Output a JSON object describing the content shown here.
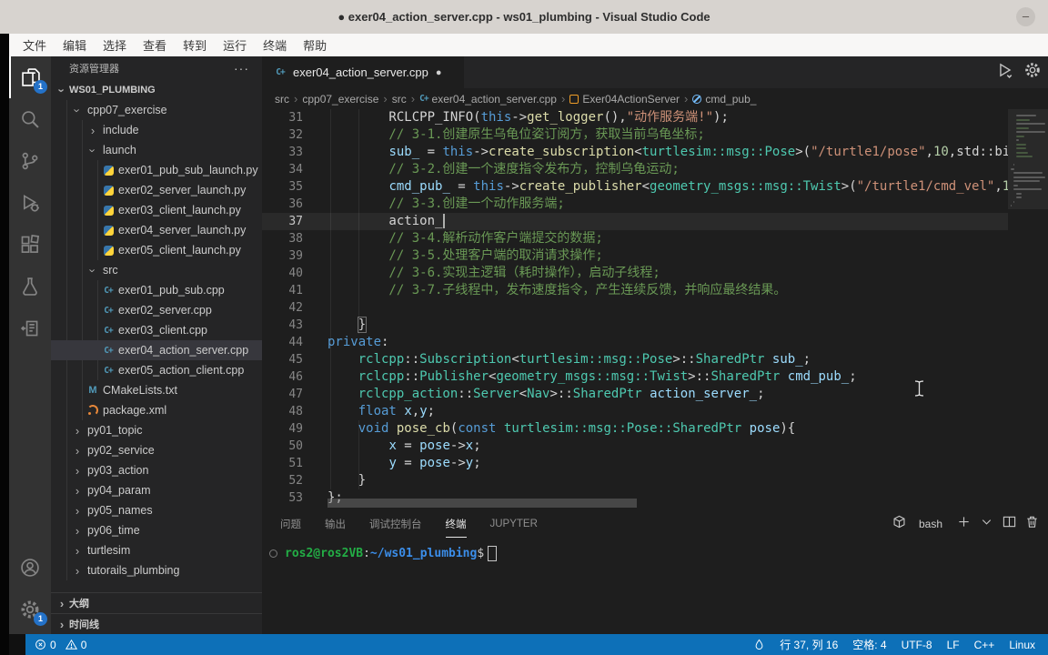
{
  "window": {
    "title": "● exer04_action_server.cpp - ws01_plumbing - Visual Studio Code",
    "minimize_glyph": "–"
  },
  "menu_items": [
    "文件",
    "编辑",
    "选择",
    "查看",
    "转到",
    "运行",
    "终端",
    "帮助"
  ],
  "activity_bar": {
    "top": [
      {
        "name": "explorer",
        "badge": "1",
        "active": true
      },
      {
        "name": "search"
      },
      {
        "name": "source-control"
      },
      {
        "name": "run-debug"
      },
      {
        "name": "extensions"
      },
      {
        "name": "testing"
      },
      {
        "name": "references"
      }
    ],
    "bottom": [
      {
        "name": "account"
      },
      {
        "name": "settings",
        "badge": "1"
      }
    ]
  },
  "sidebar": {
    "header": "资源管理器",
    "more_label": "···",
    "root": "WS01_PLUMBING",
    "tree": [
      {
        "label": "cpp07_exercise",
        "ind": 1,
        "chev": "open"
      },
      {
        "label": "include",
        "ind": 2,
        "chev": "closed"
      },
      {
        "label": "launch",
        "ind": 2,
        "chev": "open"
      },
      {
        "label": "exer01_pub_sub_launch.py",
        "ind": 3,
        "icon": "py"
      },
      {
        "label": "exer02_server_launch.py",
        "ind": 3,
        "icon": "py"
      },
      {
        "label": "exer03_client_launch.py",
        "ind": 3,
        "icon": "py"
      },
      {
        "label": "exer04_server_launch.py",
        "ind": 3,
        "icon": "py"
      },
      {
        "label": "exer05_client_launch.py",
        "ind": 3,
        "icon": "py"
      },
      {
        "label": "src",
        "ind": 2,
        "chev": "open"
      },
      {
        "label": "exer01_pub_sub.cpp",
        "ind": 3,
        "icon": "cpp"
      },
      {
        "label": "exer02_server.cpp",
        "ind": 3,
        "icon": "cpp"
      },
      {
        "label": "exer03_client.cpp",
        "ind": 3,
        "icon": "cpp"
      },
      {
        "label": "exer04_action_server.cpp",
        "ind": 3,
        "icon": "cpp",
        "selected": true
      },
      {
        "label": "exer05_action_client.cpp",
        "ind": 3,
        "icon": "cpp"
      },
      {
        "label": "CMakeLists.txt",
        "ind": 2,
        "icon": "m"
      },
      {
        "label": "package.xml",
        "ind": 2,
        "icon": "xml"
      },
      {
        "label": "py01_topic",
        "ind": 1,
        "chev": "closed"
      },
      {
        "label": "py02_service",
        "ind": 1,
        "chev": "closed"
      },
      {
        "label": "py03_action",
        "ind": 1,
        "chev": "closed"
      },
      {
        "label": "py04_param",
        "ind": 1,
        "chev": "closed"
      },
      {
        "label": "py05_names",
        "ind": 1,
        "chev": "closed"
      },
      {
        "label": "py06_time",
        "ind": 1,
        "chev": "closed"
      },
      {
        "label": "turtlesim",
        "ind": 1,
        "chev": "closed"
      },
      {
        "label": "tutorails_plumbing",
        "ind": 1,
        "chev": "closed"
      }
    ],
    "sections": [
      "大纲",
      "时间线"
    ]
  },
  "editor": {
    "tab": {
      "label": "exer04_action_server.cpp",
      "dirty": "●"
    },
    "breadcrumbs": [
      {
        "label": "src"
      },
      {
        "label": "cpp07_exercise"
      },
      {
        "label": "src"
      },
      {
        "label": "exer04_action_server.cpp",
        "icon": "cpp"
      },
      {
        "label": "Exer04ActionServer",
        "icon": "class"
      },
      {
        "label": "cmd_pub_",
        "icon": "field"
      }
    ],
    "code": {
      "cursor_line": 37,
      "lines": [
        {
          "n": 31,
          "segs": [
            [
              "p",
              "        RCLCPP_INFO("
            ],
            [
              "k",
              "this"
            ],
            [
              "p",
              "->"
            ],
            [
              "f",
              "get_logger"
            ],
            [
              "p",
              "(),"
            ],
            [
              "s",
              "\"动作服务端!\""
            ],
            [
              "p",
              ");"
            ]
          ]
        },
        {
          "n": 32,
          "segs": [
            [
              "c",
              "        // 3-1.创建原生乌龟位姿订阅方，获取当前乌龟坐标;"
            ]
          ]
        },
        {
          "n": 33,
          "segs": [
            [
              "p",
              "        "
            ],
            [
              "v",
              "sub_"
            ],
            [
              "p",
              " = "
            ],
            [
              "k",
              "this"
            ],
            [
              "p",
              "->"
            ],
            [
              "f",
              "create_subscription"
            ],
            [
              "p",
              "<"
            ],
            [
              "t",
              "turtlesim::msg::Pose"
            ],
            [
              "p",
              ">("
            ],
            [
              "s",
              "\"/turtle1/pose\""
            ],
            [
              "p",
              ","
            ],
            [
              "n",
              "10"
            ],
            [
              "p",
              ",std::bi"
            ]
          ]
        },
        {
          "n": 34,
          "segs": [
            [
              "c",
              "        // 3-2.创建一个速度指令发布方，控制乌龟运动;"
            ]
          ]
        },
        {
          "n": 35,
          "segs": [
            [
              "p",
              "        "
            ],
            [
              "v",
              "cmd_pub_"
            ],
            [
              "p",
              " = "
            ],
            [
              "k",
              "this"
            ],
            [
              "p",
              "->"
            ],
            [
              "f",
              "create_publisher"
            ],
            [
              "p",
              "<"
            ],
            [
              "t",
              "geometry_msgs::msg::Twist"
            ],
            [
              "p",
              ">("
            ],
            [
              "s",
              "\"/turtle1/cmd_vel\""
            ],
            [
              "p",
              ","
            ],
            [
              "n",
              "1"
            ]
          ]
        },
        {
          "n": 36,
          "segs": [
            [
              "c",
              "        // 3-3.创建一个动作服务端;"
            ]
          ]
        },
        {
          "n": 37,
          "cursor": true,
          "segs": [
            [
              "p",
              "        action_"
            ]
          ]
        },
        {
          "n": 38,
          "segs": [
            [
              "c",
              "        // 3-4.解析动作客户端提交的数据;"
            ]
          ]
        },
        {
          "n": 39,
          "segs": [
            [
              "c",
              "        // 3-5.处理客户端的取消请求操作;"
            ]
          ]
        },
        {
          "n": 40,
          "segs": [
            [
              "c",
              "        // 3-6.实现主逻辑（耗时操作），启动子线程;"
            ]
          ]
        },
        {
          "n": 41,
          "segs": [
            [
              "c",
              "        // 3-7.子线程中，发布速度指令，产生连续反馈，并响应最终结果。"
            ]
          ]
        },
        {
          "n": 42,
          "segs": []
        },
        {
          "n": 43,
          "segs": [
            [
              "p",
              "    "
            ],
            [
              "pb",
              "}"
            ]
          ]
        },
        {
          "n": 44,
          "segs": [
            [
              "k",
              "private"
            ],
            [
              "p",
              ":"
            ]
          ]
        },
        {
          "n": 45,
          "segs": [
            [
              "p",
              "    "
            ],
            [
              "t",
              "rclcpp"
            ],
            [
              "p",
              "::"
            ],
            [
              "t",
              "Subscription"
            ],
            [
              "p",
              "<"
            ],
            [
              "t",
              "turtlesim::msg::Pose"
            ],
            [
              "p",
              ">::"
            ],
            [
              "t",
              "SharedPtr"
            ],
            [
              "p",
              " "
            ],
            [
              "v",
              "sub_"
            ],
            [
              "p",
              ";"
            ]
          ]
        },
        {
          "n": 46,
          "segs": [
            [
              "p",
              "    "
            ],
            [
              "t",
              "rclcpp"
            ],
            [
              "p",
              "::"
            ],
            [
              "t",
              "Publisher"
            ],
            [
              "p",
              "<"
            ],
            [
              "t",
              "geometry_msgs::msg::Twist"
            ],
            [
              "p",
              ">::"
            ],
            [
              "t",
              "SharedPtr"
            ],
            [
              "p",
              " "
            ],
            [
              "v",
              "cmd_pub_"
            ],
            [
              "p",
              ";"
            ]
          ]
        },
        {
          "n": 47,
          "segs": [
            [
              "p",
              "    "
            ],
            [
              "t",
              "rclcpp_action"
            ],
            [
              "p",
              "::"
            ],
            [
              "t",
              "Server"
            ],
            [
              "p",
              "<"
            ],
            [
              "t",
              "Nav"
            ],
            [
              "p",
              ">::"
            ],
            [
              "t",
              "SharedPtr"
            ],
            [
              "p",
              " "
            ],
            [
              "v",
              "action_server_"
            ],
            [
              "p",
              ";"
            ]
          ]
        },
        {
          "n": 48,
          "segs": [
            [
              "p",
              "    "
            ],
            [
              "k",
              "float"
            ],
            [
              "p",
              " "
            ],
            [
              "v",
              "x"
            ],
            [
              "p",
              ","
            ],
            [
              "v",
              "y"
            ],
            [
              "p",
              ";"
            ]
          ]
        },
        {
          "n": 49,
          "segs": [
            [
              "p",
              "    "
            ],
            [
              "k",
              "void"
            ],
            [
              "p",
              " "
            ],
            [
              "f",
              "pose_cb"
            ],
            [
              "p",
              "("
            ],
            [
              "k",
              "const"
            ],
            [
              "p",
              " "
            ],
            [
              "t",
              "turtlesim::msg::Pose::SharedPtr"
            ],
            [
              "p",
              " "
            ],
            [
              "v",
              "pose"
            ],
            [
              "p",
              "){"
            ]
          ]
        },
        {
          "n": 50,
          "segs": [
            [
              "p",
              "        "
            ],
            [
              "v",
              "x"
            ],
            [
              "p",
              " = "
            ],
            [
              "v",
              "pose"
            ],
            [
              "p",
              "->"
            ],
            [
              "v",
              "x"
            ],
            [
              "p",
              ";"
            ]
          ]
        },
        {
          "n": 51,
          "segs": [
            [
              "p",
              "        "
            ],
            [
              "v",
              "y"
            ],
            [
              "p",
              " = "
            ],
            [
              "v",
              "pose"
            ],
            [
              "p",
              "->"
            ],
            [
              "v",
              "y"
            ],
            [
              "p",
              ";"
            ]
          ]
        },
        {
          "n": 52,
          "segs": [
            [
              "p",
              "    }"
            ]
          ]
        },
        {
          "n": 53,
          "segs": [
            [
              "p",
              "};"
            ]
          ]
        }
      ]
    }
  },
  "panel": {
    "tabs": [
      {
        "label": "问题"
      },
      {
        "label": "输出"
      },
      {
        "label": "调试控制台"
      },
      {
        "label": "终端",
        "active": true
      },
      {
        "label": "JUPYTER"
      }
    ],
    "shell": "bash",
    "terminal": {
      "user": "ros2@ros2VB",
      "sep": ":",
      "path": "~/ws01_plumbing",
      "prompt_char": "$"
    }
  },
  "status_bar": {
    "left": [
      {
        "icon": "error",
        "text": "0"
      },
      {
        "icon": "warning",
        "text": "0"
      }
    ],
    "right": [
      {
        "icon": "ros",
        "text": ""
      },
      {
        "text": "行 37, 列 16"
      },
      {
        "text": "空格: 4"
      },
      {
        "text": "UTF-8"
      },
      {
        "text": "LF"
      },
      {
        "text": "C++"
      },
      {
        "text": "Linux"
      }
    ],
    "accent": "#0d70b8"
  }
}
